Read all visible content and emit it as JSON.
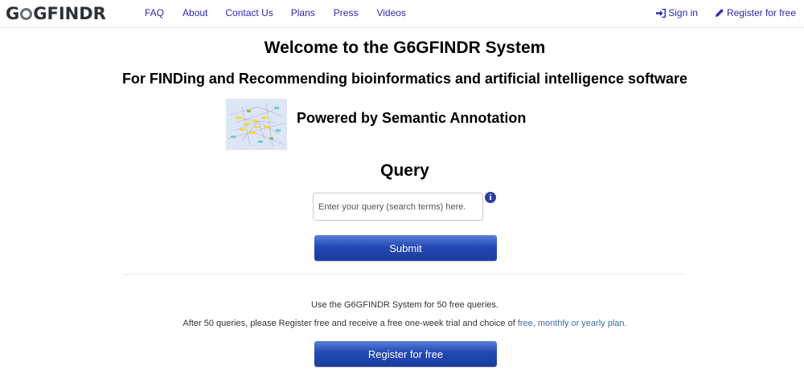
{
  "brand": {
    "logo_pre": "G",
    "logo_post": "GFINDR"
  },
  "nav": {
    "links": [
      "FAQ",
      "About",
      "Contact Us",
      "Plans",
      "Press",
      "Videos"
    ],
    "sign_in": "Sign in",
    "register": "Register for free"
  },
  "main": {
    "title": "Welcome to the G6GFINDR System",
    "subtitle": "For FINDing and Recommending bioinformatics and artificial intelligence software",
    "powered": "Powered by Semantic Annotation",
    "query_heading": "Query",
    "query_placeholder": "Enter your query (search terms) here.",
    "info_icon": "i",
    "submit_label": "Submit",
    "free_text": "Use the G6GFINDR System for 50 free queries.",
    "after_text": "After 50 queries, please Register free and receive a free one-week trial and choice of ",
    "plan_link": "free, monthly or yearly plan.",
    "register_label": "Register for free"
  },
  "colors": {
    "link": "#2a2aaf",
    "button": "#2349b4",
    "plan_link": "#3b6ea8"
  }
}
